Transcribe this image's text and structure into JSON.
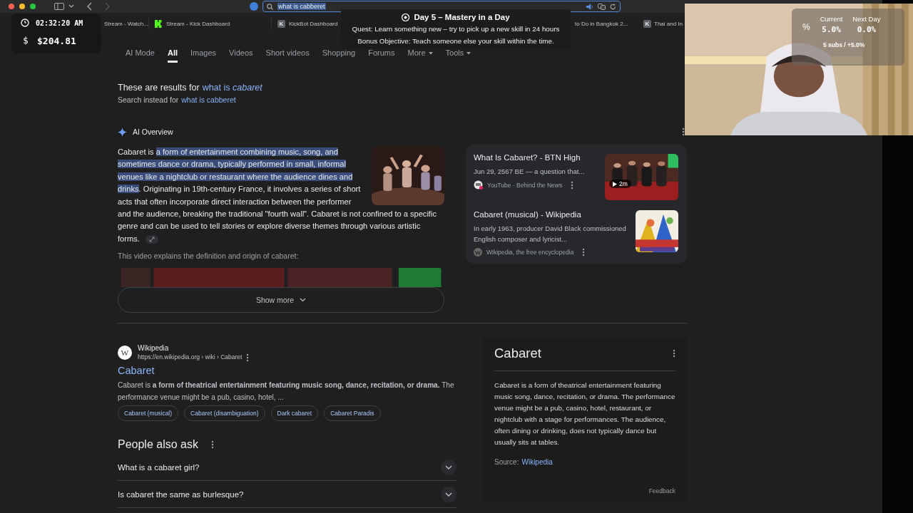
{
  "browser": {
    "address": "what is cabberet",
    "tabs": [
      {
        "title": "Stream - Watch..."
      },
      {
        "title": "Stream - Kick Dashboard",
        "kind": "kick"
      },
      {
        "title": "KickBot Dashboard",
        "kind": "letter",
        "letter": "K"
      },
      {
        "title": "to Do in Bangkok 2..."
      },
      {
        "title": "Thai and In",
        "kind": "letter",
        "letter": "K"
      }
    ]
  },
  "stream_overlay": {
    "clock": "02:32:20 AM",
    "currency": "$",
    "balance": "$204.81"
  },
  "quest": {
    "title": "Day 5 – Mastery in a Day",
    "quest": "Quest: Learn something new – try to pick up a new skill in 24 hours",
    "bonus": "Bonus Objective: Teach someone else your skill within the time."
  },
  "webcam": {
    "kind": "picture",
    "stats": {
      "symbol": "%",
      "columns": [
        {
          "label": "Current",
          "value": "5.0%"
        },
        {
          "label": "Next Day",
          "value": "0.0%"
        }
      ],
      "summary": "5 subs / +5.0%"
    }
  },
  "search_nav": [
    {
      "label": "AI Mode",
      "selected": false,
      "dropdown": false
    },
    {
      "label": "All",
      "selected": true,
      "dropdown": false
    },
    {
      "label": "Images",
      "selected": false,
      "dropdown": false
    },
    {
      "label": "Videos",
      "selected": false,
      "dropdown": false
    },
    {
      "label": "Short videos",
      "selected": false,
      "dropdown": false
    },
    {
      "label": "Shopping",
      "selected": false,
      "dropdown": false
    },
    {
      "label": "Forums",
      "selected": false,
      "dropdown": false
    },
    {
      "label": "More",
      "selected": false,
      "dropdown": true
    },
    {
      "label": "Tools",
      "selected": false,
      "dropdown": true
    }
  ],
  "correction": {
    "prefix": "These are results for",
    "link": "what is *cabaret*",
    "alt_prefix": "Search instead for",
    "alt_link": "what is cabberet"
  },
  "ai_overview": {
    "title": "AI Overview",
    "before": "Cabaret is ",
    "selected_text": "a form of entertainment combining music, song, and sometimes dance or drama, typically performed in small, informal venues like a nightclub or restaurant where the audience dines and drinks",
    "after": ". Originating in 19th-century France, it involves a series of short acts that often incorporate direct interaction between the performer and the audience, breaking the traditional \"fourth wall\". Cabaret is not confined to a specific genre and can be used to tell stories or explore diverse themes through various artistic forms.",
    "video_caption": "This video explains the definition and origin of cabaret:",
    "show_more": "Show more",
    "sources": [
      {
        "kind": "video",
        "title": "What Is Cabaret? - BTN High",
        "snippet": "Jun 29, 2567 BE — a question that...",
        "site": "YouTube · Behind the News",
        "duration": "2m"
      },
      {
        "kind": "page",
        "title": "Cabaret (musical) - Wikipedia",
        "snippet": "In early 1963, producer David Black commissioned English composer and lyricist...",
        "site": "Wikipedia, the free encyclopedia"
      }
    ]
  },
  "result": {
    "site": "Wikipedia",
    "logo_letter": "W",
    "url": "https://en.wikipedia.org › wiki › Cabaret",
    "title": "Cabaret",
    "snippet": "Cabaret is **a form of theatrical entertainment featuring music song, dance, recitation, or drama.** The performance venue might be a pub, casino, hotel, ...",
    "chips": [
      "Cabaret (musical)",
      "Cabaret (disambiguation)",
      "Dark cabaret",
      "Cabaret Paradis"
    ]
  },
  "people_also_ask": {
    "title": "People also ask",
    "questions": [
      "What is a cabaret girl?",
      "Is cabaret the same as burlesque?"
    ]
  },
  "knowledge_panel": {
    "title": "Cabaret",
    "description": "Cabaret is a form of theatrical entertainment featuring music song, dance, recitation, or drama. The performance venue might be a pub, casino, hotel, restaurant, or nightclub with a stage for performances. The audience, often dining or drinking, does not typically dance but usually sits at tables.",
    "source_label": "Source:",
    "source_link": "Wikipedia",
    "feedback": "Feedback"
  }
}
